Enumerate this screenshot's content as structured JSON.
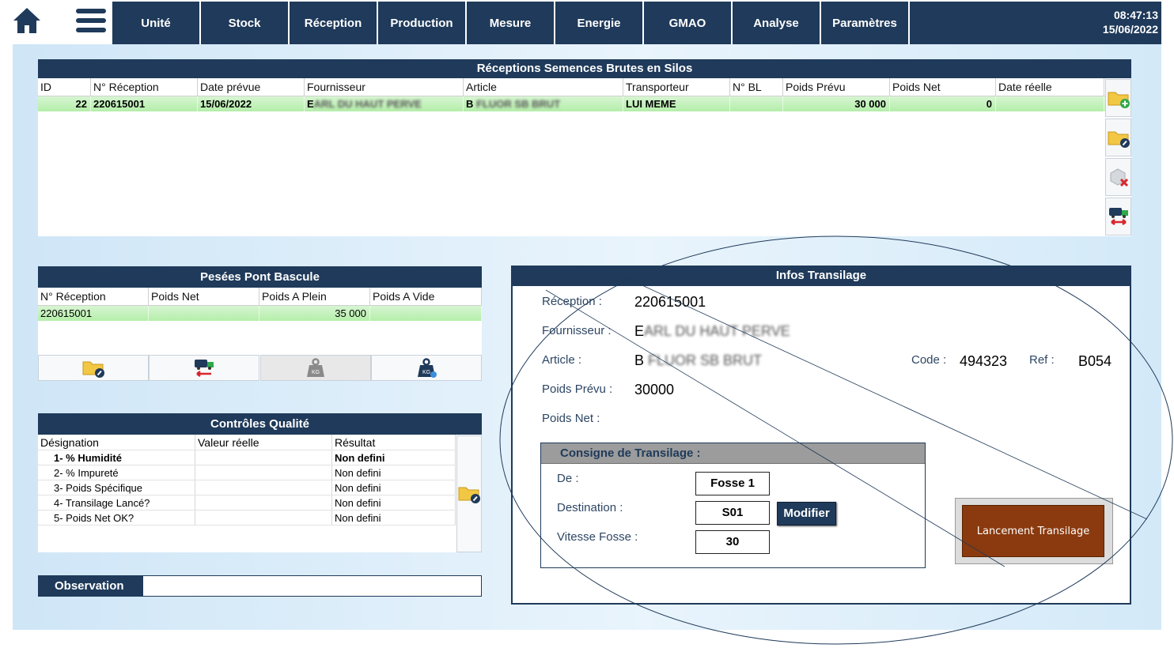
{
  "topbar": {
    "home_icon": "home-icon",
    "menu_icon": "hamburger-icon",
    "nav": [
      "Unité",
      "Stock",
      "Réception",
      "Production",
      "Mesure",
      "Energie",
      "GMAO",
      "Analyse",
      "Paramètres"
    ],
    "time": "08:47:13",
    "date": "15/06/2022"
  },
  "receptions": {
    "title": "Réceptions Semences Brutes en Silos",
    "columns": [
      "ID",
      "N° Réception",
      "Date prévue",
      "Fournisseur",
      "Article",
      "Transporteur",
      "N° BL",
      "Poids Prévu",
      "Poids Net",
      "Date réelle"
    ],
    "rows": [
      {
        "id": "22",
        "numero": "220615001",
        "date_prevue": "15/06/2022",
        "fournisseur_prefix": "E",
        "fournisseur_blur": "ARL DU HAUT PERVE",
        "article_prefix": "B",
        "article_blur": "FLUOR SB BRUT",
        "transporteur": "LUI MEME",
        "bl": "",
        "poids_prevu": "30 000",
        "poids_net": "0",
        "date_reelle": ""
      }
    ],
    "side_buttons": [
      "folder-add-icon",
      "folder-edit-icon",
      "box-delete-icon",
      "truck-transfer-icon"
    ]
  },
  "pesees": {
    "title": "Pesées Pont Bascule",
    "columns": [
      "N° Réception",
      "Poids Net",
      "Poids A Plein",
      "Poids A Vide"
    ],
    "rows": [
      {
        "numero": "220615001",
        "poids_net": "",
        "poids_plein": "35 000",
        "poids_vide": ""
      }
    ],
    "buttons": [
      "folder-edit-icon",
      "truck-transfer-icon",
      "weight-kg-icon",
      "weight-kg-edit-icon"
    ]
  },
  "controles": {
    "title": "Contrôles Qualité",
    "columns": [
      "Désignation",
      "Valeur réelle",
      "Résultat"
    ],
    "rows": [
      {
        "designation": "1- % Humidité",
        "valeur": "",
        "resultat": "Non defini",
        "bold": true
      },
      {
        "designation": "2- % Impureté",
        "valeur": "",
        "resultat": "Non defini",
        "bold": false
      },
      {
        "designation": "3- Poids Spécifique",
        "valeur": "",
        "resultat": "Non defini",
        "bold": false
      },
      {
        "designation": "4- Transilage Lancé?",
        "valeur": "",
        "resultat": "Non defini",
        "bold": false
      },
      {
        "designation": "5- Poids Net OK?",
        "valeur": "",
        "resultat": "Non defini",
        "bold": false
      }
    ]
  },
  "observation": {
    "label": "Observation",
    "value": ""
  },
  "infos": {
    "title": "Infos Transilage",
    "reception_label": "Réception :",
    "reception_value": "220615001",
    "fournisseur_label": "Fournisseur :",
    "fournisseur_prefix": "E",
    "fournisseur_blur": "ARL DU HAUT PERVE",
    "article_label": "Article :",
    "article_prefix": "B",
    "article_blur": "FLUOR SB BRUT",
    "code_label": "Code :",
    "code_value": "494323",
    "ref_label": "Ref :",
    "ref_value": "B054",
    "poids_prevu_label": "Poids Prévu :",
    "poids_prevu_value": "30000",
    "poids_net_label": "Poids Net :",
    "poids_net_value": ""
  },
  "consigne": {
    "title": "Consigne de Transilage :",
    "de_label": "De :",
    "de_value": "Fosse 1",
    "destination_label": "Destination :",
    "destination_value": "S01",
    "modifier_label": "Modifier",
    "vitesse_label": "Vitesse Fosse :",
    "vitesse_value": "30"
  },
  "launch_label": "Lancement Transilage",
  "colors": {
    "navy": "#1f3a5a",
    "launch": "#8a3a0e",
    "row_green": "#b4eea9"
  }
}
